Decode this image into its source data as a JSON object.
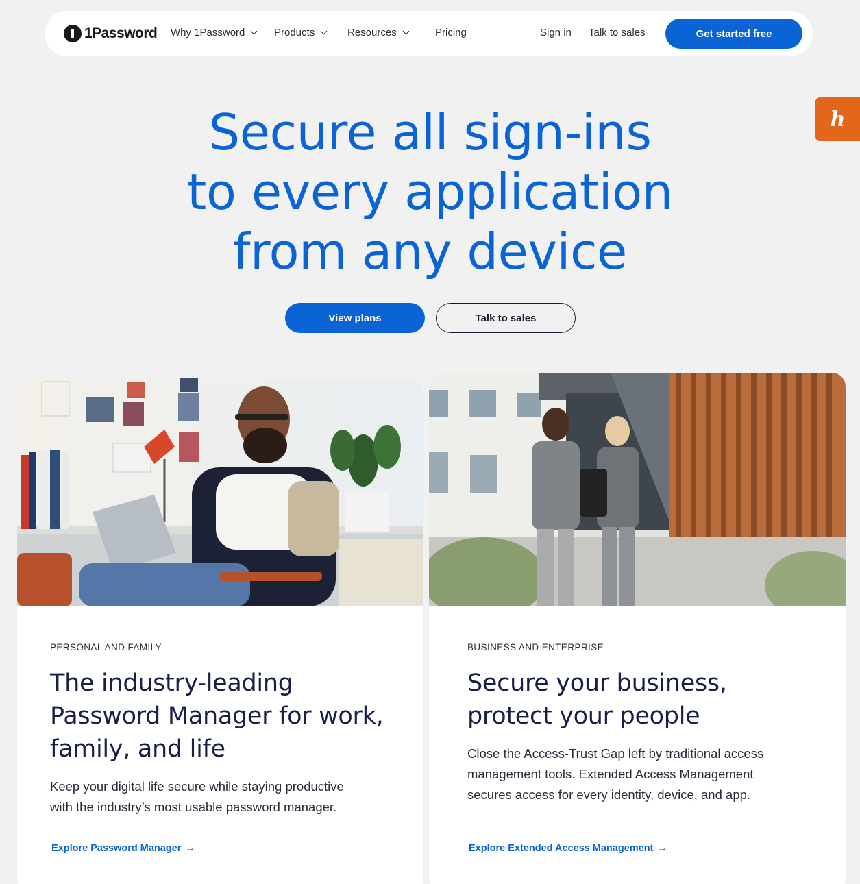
{
  "nav": {
    "logo_text": "1Password",
    "items": [
      {
        "label": "Why 1Password"
      },
      {
        "label": "Products"
      },
      {
        "label": "Resources"
      },
      {
        "label": "Pricing"
      }
    ],
    "sign_in": "Sign in",
    "talk_to_sales": "Talk to sales",
    "cta": "Get started free"
  },
  "honey_badge": "h",
  "hero": {
    "lines": [
      "Secure all sign-ins",
      "to every application",
      "from any device"
    ],
    "primary_button": "View plans",
    "secondary_button": "Talk to sales"
  },
  "cards": {
    "personal": {
      "eyebrow": "PERSONAL AND FAMILY",
      "title_lines": [
        "The industry-leading",
        "Password Manager for work,",
        "family, and life"
      ],
      "body_lines": [
        "Keep your digital life secure while staying productive",
        "with the industry’s most usable password manager."
      ],
      "link": "Explore Password Manager",
      "link_arrow": "→"
    },
    "business": {
      "eyebrow": "BUSINESS AND ENTERPRISE",
      "title_lines": [
        "Secure your business,",
        "protect your people"
      ],
      "body_lines": [
        "Close the Access-Trust Gap left by traditional access",
        "management tools. Extended Access Management",
        "secures access for every identity, device, and app."
      ],
      "link": "Explore Extended Access Management",
      "link_arrow": "→"
    }
  },
  "colors": {
    "brand_blue": "#0a64d6",
    "page_bg": "#f1f1f1",
    "honey_orange": "#e4661b"
  }
}
